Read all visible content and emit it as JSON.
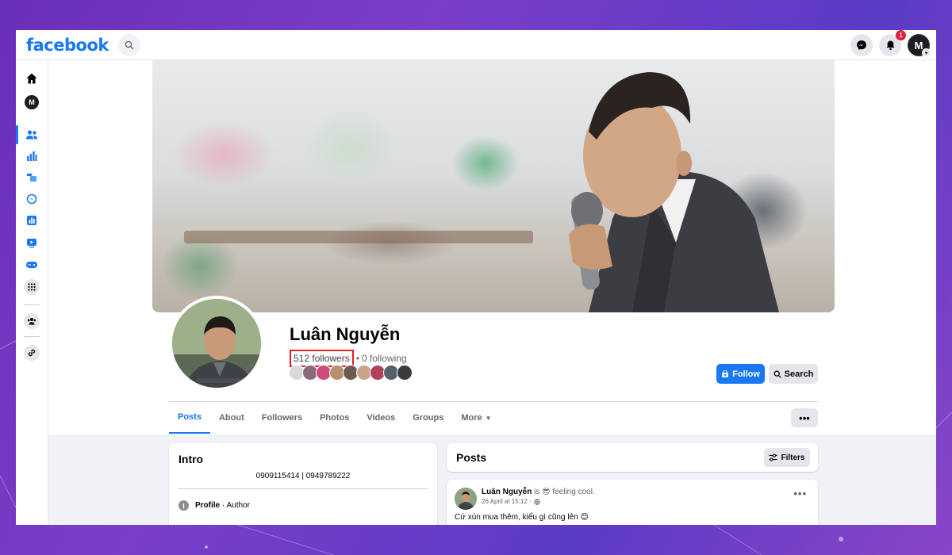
{
  "header": {
    "logo": "facebook",
    "notification_count": "1",
    "account_initial": "M"
  },
  "profile": {
    "name": "Luân Nguyễn",
    "followers": "512 followers",
    "separator": "•",
    "following": "0 following",
    "follow_label": "Follow",
    "search_label": "Search"
  },
  "tabs": [
    {
      "label": "Posts"
    },
    {
      "label": "About"
    },
    {
      "label": "Followers"
    },
    {
      "label": "Photos"
    },
    {
      "label": "Videos"
    },
    {
      "label": "Groups"
    },
    {
      "label": "More"
    }
  ],
  "more_menu_label": "•••",
  "intro": {
    "title": "Intro",
    "phone": "0909115414 | 0949789222",
    "profile_label": "Profile",
    "profile_type": " · Author"
  },
  "posts": {
    "title": "Posts",
    "filters_label": "Filters"
  },
  "post": {
    "author": "Luân Nguyễn",
    "activity": " is 😎 feeling cool.",
    "time": "26 April at 15:12 ·",
    "text": "Cứ xún mua thêm, kiểu gì cũng lên 😊",
    "menu_label": "•••"
  },
  "colors": {
    "brand": "#1877f2",
    "highlight": "#e02020",
    "badge": "#e41e3f"
  }
}
